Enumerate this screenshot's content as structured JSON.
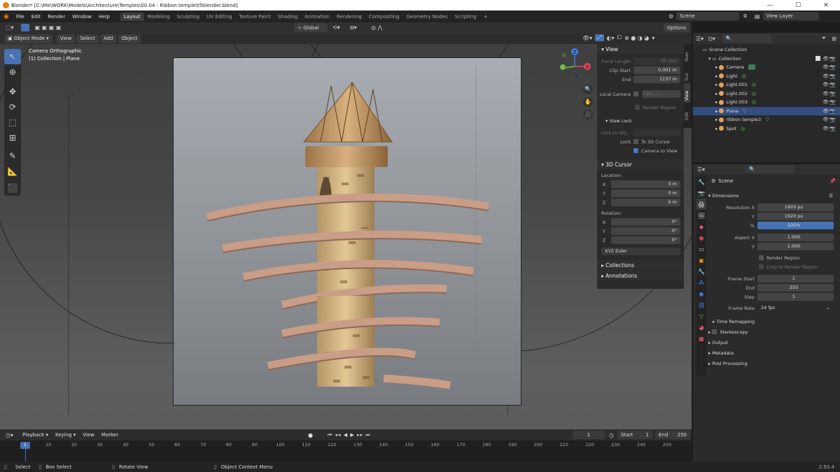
{
  "window": {
    "title": "Blender* [C:\\Me\\WORK\\Models\\Architecture\\Temples\\00.04 - Ribbon temple\\t5blender.blend]"
  },
  "menu": [
    "File",
    "Edit",
    "Render",
    "Window",
    "Help"
  ],
  "workspaces": [
    "Layout",
    "Modeling",
    "Sculpting",
    "UV Editing",
    "Texture Paint",
    "Shading",
    "Animation",
    "Rendering",
    "Compositing",
    "Geometry Nodes",
    "Scripting"
  ],
  "workspace_active": "Layout",
  "scene_field": "Scene",
  "view_layer_field": "View Layer",
  "viewport_header": {
    "mode": "Object Mode",
    "menus": [
      "View",
      "Select",
      "Add",
      "Object"
    ],
    "orientation": "Global",
    "options": "Options"
  },
  "viewport": {
    "overlay_line1": "Camera Orthographic",
    "overlay_line2": "(1) Collection | Plane",
    "gizmo": {
      "z": "Z",
      "y": "Y",
      "x": "X"
    }
  },
  "npanel": {
    "tabs": [
      "Item",
      "Tool",
      "View",
      "Edit"
    ],
    "active_tab": "View",
    "view_title": "View",
    "focal_length_label": "Focal Length",
    "focal_length": "50 mm",
    "clip_start_label": "Clip Start",
    "clip_start": "0.001 m",
    "end_label": "End",
    "end": "1137 m",
    "local_camera_label": "Local Camera",
    "local_camera_value": "Cam...",
    "render_region": "Render Region",
    "view_lock_title": "View Lock",
    "lock_to_obj_label": "Lock to Obj...",
    "lock_label": "Lock",
    "to_3d_cursor": "To 3D Cursor",
    "camera_to_view": "Camera to View",
    "cursor_title": "3D Cursor",
    "location_label": "Location:",
    "loc": [
      {
        "axis": "X",
        "value": "0 m"
      },
      {
        "axis": "Y",
        "value": "0 m"
      },
      {
        "axis": "Z",
        "value": "0 m"
      }
    ],
    "rotation_label": "Rotation:",
    "rot": [
      {
        "axis": "X",
        "value": "0°"
      },
      {
        "axis": "Y",
        "value": "0°"
      },
      {
        "axis": "Z",
        "value": "0°"
      }
    ],
    "rotation_mode": "XYZ Euler",
    "collections": "Collections",
    "annotations": "Annotations"
  },
  "outliner": {
    "root": "Scene Collection",
    "collection": "Collection",
    "items": [
      {
        "name": "Camera",
        "icon_color": "#e0a060"
      },
      {
        "name": "Light",
        "icon_color": "#e0a060"
      },
      {
        "name": "Light.001",
        "icon_color": "#e0a060"
      },
      {
        "name": "Light.002",
        "icon_color": "#e0a060"
      },
      {
        "name": "Light.003",
        "icon_color": "#e0a060"
      },
      {
        "name": "Plane",
        "icon_color": "#e0a060"
      },
      {
        "name": "ribbon temple3",
        "icon_color": "#e0a060"
      },
      {
        "name": "Spot",
        "icon_color": "#e0a060"
      }
    ],
    "selected": "Plane"
  },
  "properties": {
    "context": "Scene",
    "dimensions_title": "Dimensions",
    "res_x_label": "Resolution X",
    "res_x": "1920 px",
    "res_y_label": "Y",
    "res_y": "1920 px",
    "percent_label": "%",
    "percent": "100%",
    "aspect_x_label": "Aspect X",
    "aspect_x": "1.000",
    "aspect_y_label": "Y",
    "aspect_y": "1.000",
    "render_region": "Render Region",
    "crop_region": "Crop to Render Region",
    "frame_start_label": "Frame Start",
    "frame_start": "1",
    "frame_end_label": "End",
    "frame_end": "250",
    "frame_step_label": "Step",
    "frame_step": "1",
    "frame_rate_label": "Frame Rate",
    "frame_rate": "24 fps",
    "time_remapping": "Time Remapping",
    "stereoscopy": "Stereoscopy",
    "output": "Output",
    "metadata": "Metadata",
    "post_processing": "Post Processing"
  },
  "timeline": {
    "menus": [
      "Playback",
      "Keying",
      "View",
      "Marker"
    ],
    "current_frame": "1",
    "start_label": "Start",
    "start": "1",
    "end_label": "End",
    "end": "250",
    "ticks": [
      "1",
      "10",
      "20",
      "30",
      "40",
      "50",
      "60",
      "70",
      "80",
      "90",
      "100",
      "110",
      "120",
      "130",
      "140",
      "150",
      "160",
      "170",
      "180",
      "190",
      "200",
      "210",
      "220",
      "230",
      "240",
      "250"
    ]
  },
  "statusbar": {
    "select": "Select",
    "box_select": "Box Select",
    "rotate_view": "Rotate View",
    "context_menu": "Object Context Menu",
    "version": "2.93.4"
  }
}
